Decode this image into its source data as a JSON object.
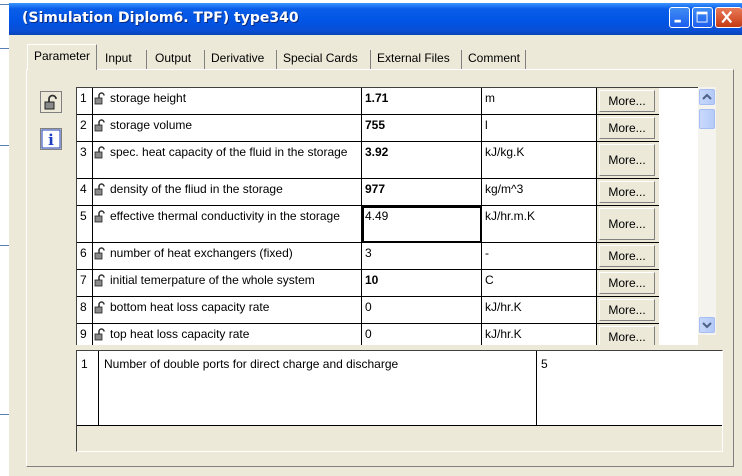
{
  "window": {
    "title": "(Simulation Diplom6. TPF) type340",
    "colors": {
      "titlebar": "#0055e5",
      "face": "#ece9d8"
    }
  },
  "title_buttons": {
    "minimize": "minimize-icon",
    "maximize": "maximize-icon",
    "close": "close-icon"
  },
  "tabs": [
    "Parameter",
    "Input",
    "Output",
    "Derivative",
    "Special Cards",
    "External Files",
    "Comment"
  ],
  "active_tab": "Parameter",
  "side_icons": {
    "lock": "padlock-icon",
    "info": "info-icon"
  },
  "parameters": [
    {
      "num": "1",
      "name": "storage height",
      "value": "1.71",
      "unit": "m",
      "more": "More...",
      "bold": true
    },
    {
      "num": "2",
      "name": "storage volume",
      "value": "755",
      "unit": "l",
      "more": "More...",
      "bold": true
    },
    {
      "num": "3",
      "name": "spec. heat capacity of the fluid in the storage",
      "value": "3.92",
      "unit": "kJ/kg.K",
      "more": "More...",
      "bold": true
    },
    {
      "num": "4",
      "name": "density of the fliud in the storage",
      "value": "977",
      "unit": "kg/m^3",
      "more": "More...",
      "bold": true
    },
    {
      "num": "5",
      "name": "effective thermal conductivity in the storage",
      "value": "4.49",
      "unit": "kJ/hr.m.K",
      "more": "More...",
      "bold": false
    },
    {
      "num": "6",
      "name": "number of heat exchangers (fixed)",
      "value": "3",
      "unit": "-",
      "more": "More...",
      "bold": false
    },
    {
      "num": "7",
      "name": "initial temerpature of the whole system",
      "value": "10",
      "unit": "C",
      "more": "More...",
      "bold": true
    },
    {
      "num": "8",
      "name": "bottom heat loss capacity rate",
      "value": "0",
      "unit": "kJ/hr.K",
      "more": "More...",
      "bold": false
    },
    {
      "num": "9",
      "name": "top heat loss capacity rate",
      "value": "0",
      "unit": "kJ/hr.K",
      "more": "More...",
      "bold": false
    }
  ],
  "description": {
    "num": "1",
    "text": "Number of double ports for direct charge and discharge",
    "value": "5"
  }
}
